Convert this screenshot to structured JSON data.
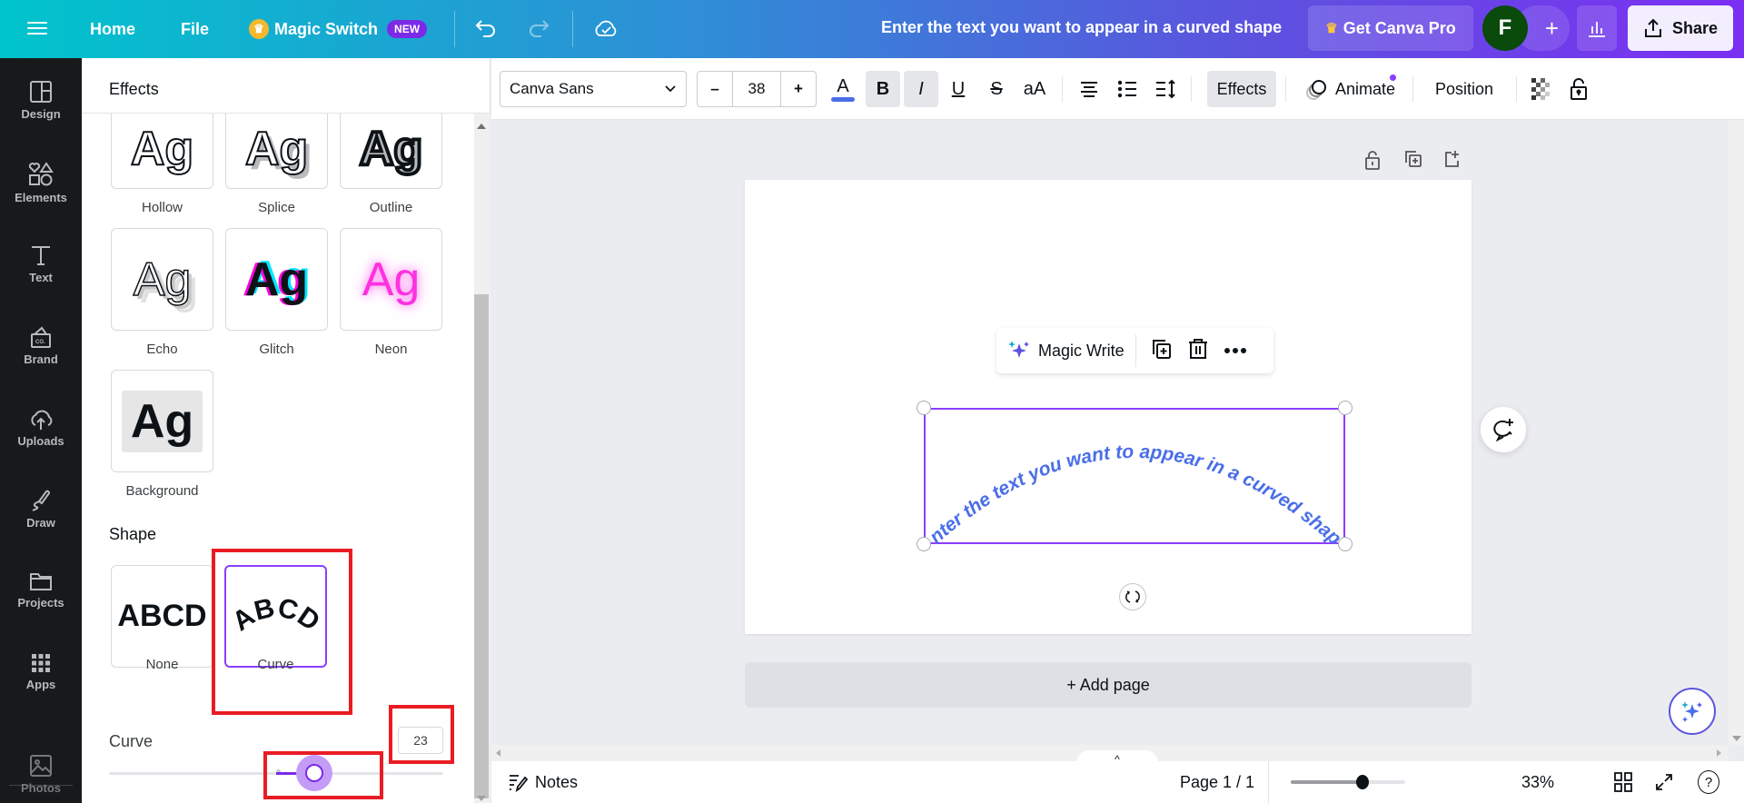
{
  "topbar": {
    "home": "Home",
    "file": "File",
    "magic_switch": "Magic Switch",
    "new_badge": "NEW",
    "doc_title": "Enter the text you want to appear in a curved shape",
    "get_pro": "Get Canva Pro",
    "avatar_initial": "F",
    "share": "Share"
  },
  "rail": {
    "items": [
      {
        "label": "Design",
        "icon": "design-icon"
      },
      {
        "label": "Elements",
        "icon": "elements-icon"
      },
      {
        "label": "Text",
        "icon": "text-icon"
      },
      {
        "label": "Brand",
        "icon": "brand-icon"
      },
      {
        "label": "Uploads",
        "icon": "uploads-icon"
      },
      {
        "label": "Draw",
        "icon": "draw-icon"
      },
      {
        "label": "Projects",
        "icon": "projects-icon"
      },
      {
        "label": "Apps",
        "icon": "apps-icon"
      },
      {
        "label": "Photos",
        "icon": "photos-icon"
      }
    ]
  },
  "panel": {
    "title": "Effects",
    "effects": [
      {
        "label": "Hollow",
        "preview": "Ag"
      },
      {
        "label": "Splice",
        "preview": "Ag"
      },
      {
        "label": "Outline",
        "preview": "Ag"
      },
      {
        "label": "Echo",
        "preview": "Ag"
      },
      {
        "label": "Glitch",
        "preview": "Ag"
      },
      {
        "label": "Neon",
        "preview": "Ag"
      },
      {
        "label": "Background",
        "preview": "Ag"
      }
    ],
    "shape_heading": "Shape",
    "shapes": [
      {
        "label": "None",
        "preview": "ABCD",
        "selected": false
      },
      {
        "label": "Curve",
        "preview": "ABCD",
        "selected": true
      }
    ],
    "curve_label": "Curve",
    "curve_value": "23",
    "curve_slider_min": -100,
    "curve_slider_max": 100,
    "curve_slider_value": 23
  },
  "toolbar": {
    "font": "Canva Sans",
    "size_minus": "–",
    "font_size": "38",
    "size_plus": "+",
    "text_color_glyph": "A",
    "text_color": "#4a6ee8",
    "bold": "B",
    "italic": "I",
    "underline": "U",
    "strike": "S",
    "case": "aA",
    "effects": "Effects",
    "animate": "Animate",
    "position": "Position"
  },
  "canvas": {
    "curved_text": "Enter the text you want to appear in a curved shape",
    "text_color": "#4a6ee8",
    "selection_color": "#8b3dff",
    "magic_write": "Magic Write",
    "add_page": "+ Add page"
  },
  "footer": {
    "notes": "Notes",
    "page_indicator": "Page 1 / 1",
    "zoom_percent": "33%",
    "zoom_slider_fraction": 0.33
  }
}
